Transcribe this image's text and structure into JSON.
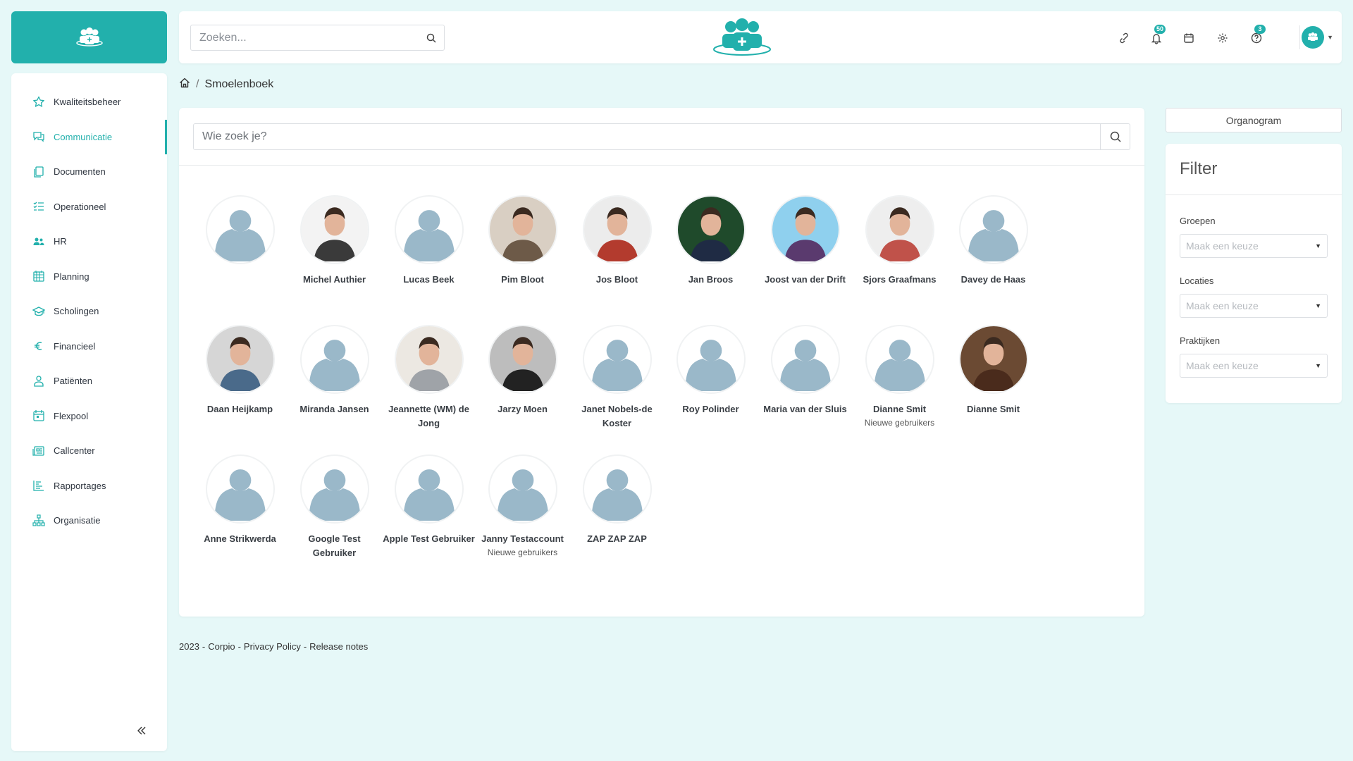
{
  "colors": {
    "accent": "#22b0ac",
    "background": "#e6f8f8",
    "avatar_placeholder": "#9ab8c9"
  },
  "sidebar": {
    "items": [
      {
        "label": "Kwaliteitsbeheer",
        "icon": "star-icon"
      },
      {
        "label": "Communicatie",
        "icon": "chat-icon",
        "active": true
      },
      {
        "label": "Documenten",
        "icon": "documents-icon"
      },
      {
        "label": "Operationeel",
        "icon": "checklist-icon"
      },
      {
        "label": "HR",
        "icon": "people-icon"
      },
      {
        "label": "Planning",
        "icon": "calendar-grid-icon"
      },
      {
        "label": "Scholingen",
        "icon": "graduation-cap-icon"
      },
      {
        "label": "Financieel",
        "icon": "euro-icon"
      },
      {
        "label": "Patiënten",
        "icon": "patient-icon"
      },
      {
        "label": "Flexpool",
        "icon": "calendar-icon"
      },
      {
        "label": "Callcenter",
        "icon": "newspaper-icon"
      },
      {
        "label": "Rapportages",
        "icon": "bar-chart-icon"
      },
      {
        "label": "Organisatie",
        "icon": "org-chart-icon"
      }
    ],
    "collapse_icon": "double-chevron-left-icon"
  },
  "topbar": {
    "search_placeholder": "Zoeken...",
    "icons": [
      {
        "name": "link-icon",
        "badge": ""
      },
      {
        "name": "bell-icon",
        "badge": "50"
      },
      {
        "name": "calendar-icon",
        "badge": ""
      },
      {
        "name": "gear-icon",
        "badge": ""
      },
      {
        "name": "help-icon",
        "badge": "3"
      }
    ]
  },
  "breadcrumb": {
    "current": "Smoelenboek"
  },
  "main": {
    "search_placeholder": "Wie zoek je?",
    "people": [
      {
        "name": "",
        "sub": "",
        "photo": false
      },
      {
        "name": "Michel Authier",
        "sub": "",
        "photo": true,
        "tone": "#3a3a3a",
        "bg": "#f3f3f3"
      },
      {
        "name": "Lucas Beek",
        "sub": "",
        "photo": false
      },
      {
        "name": "Pim Bloot",
        "sub": "",
        "photo": true,
        "tone": "#6d5a48",
        "bg": "#d9cfc3"
      },
      {
        "name": "Jos Bloot",
        "sub": "",
        "photo": true,
        "tone": "#b33b2e",
        "bg": "#ececec"
      },
      {
        "name": "Jan Broos",
        "sub": "",
        "photo": true,
        "tone": "#1f2b44",
        "bg": "#1f4a2b"
      },
      {
        "name": "Joost van der Drift",
        "sub": "",
        "photo": true,
        "tone": "#5a3a6e",
        "bg": "#8fd0ee"
      },
      {
        "name": "Sjors Graafmans",
        "sub": "",
        "photo": true,
        "tone": "#c0524a",
        "bg": "#eeeeee"
      },
      {
        "name": "Davey de Haas",
        "sub": "",
        "photo": false
      },
      {
        "name": "Daan Heijkamp",
        "sub": "",
        "photo": true,
        "tone": "#4a6a8a",
        "bg": "#d6d6d6"
      },
      {
        "name": "Miranda Jansen",
        "sub": "",
        "photo": false
      },
      {
        "name": "Jeannette (WM) de Jong",
        "sub": "",
        "photo": true,
        "tone": "#9fa3a8",
        "bg": "#ece8e2"
      },
      {
        "name": "Jarzy Moen",
        "sub": "",
        "photo": true,
        "tone": "#222222",
        "bg": "#bdbdbd"
      },
      {
        "name": "Janet Nobels-de Koster",
        "sub": "",
        "photo": false
      },
      {
        "name": "Roy Polinder",
        "sub": "",
        "photo": false
      },
      {
        "name": "Maria van der Sluis",
        "sub": "",
        "photo": false
      },
      {
        "name": "Dianne Smit",
        "sub": "Nieuwe gebruikers",
        "photo": false
      },
      {
        "name": "Dianne Smit",
        "sub": "",
        "photo": true,
        "tone": "#4a2b1c",
        "bg": "#6b4a33"
      },
      {
        "name": "Anne Strikwerda",
        "sub": "",
        "photo": false
      },
      {
        "name": "Google Test Gebruiker",
        "sub": "",
        "photo": false
      },
      {
        "name": "Apple Test Gebruiker",
        "sub": "",
        "photo": false
      },
      {
        "name": "Janny Testaccount",
        "sub": "Nieuwe gebruikers",
        "photo": false
      },
      {
        "name": "ZAP ZAP ZAP",
        "sub": "",
        "photo": false
      }
    ]
  },
  "organogram_label": "Organogram",
  "filter": {
    "title": "Filter",
    "fields": [
      {
        "label": "Groepen",
        "placeholder": "Maak een keuze"
      },
      {
        "label": "Locaties",
        "placeholder": "Maak een keuze"
      },
      {
        "label": "Praktijken",
        "placeholder": "Maak een keuze"
      }
    ]
  },
  "footer": {
    "year": "2023",
    "company": "Corpio",
    "privacy": "Privacy Policy",
    "release_notes": "Release notes"
  }
}
